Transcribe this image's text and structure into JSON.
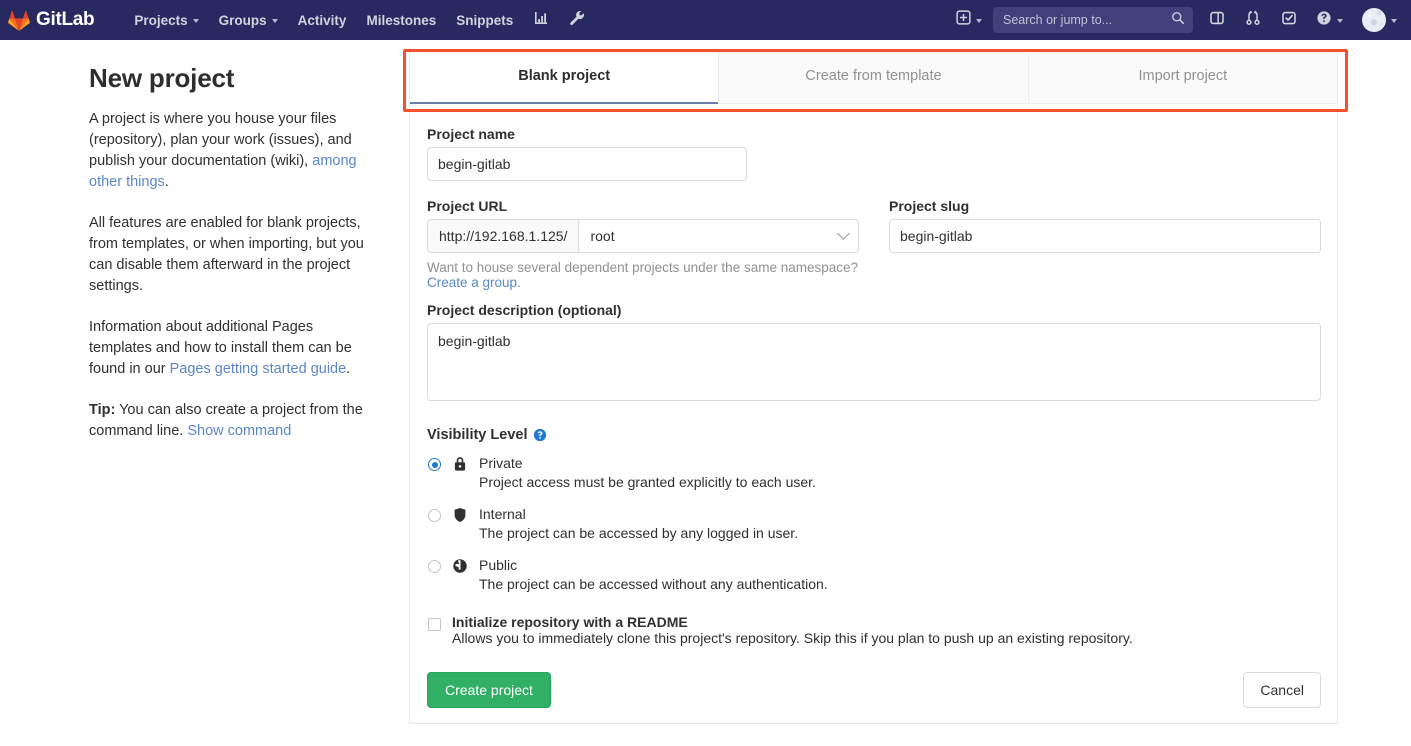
{
  "navbar": {
    "brand": "GitLab",
    "logo_icon": "gitlab-tanuki-icon",
    "items": [
      {
        "label": "Projects",
        "icon": "chevron-down-icon",
        "has_caret": true
      },
      {
        "label": "Groups",
        "icon": "chevron-down-icon",
        "has_caret": true
      },
      {
        "label": "Activity",
        "has_caret": false
      },
      {
        "label": "Milestones",
        "has_caret": false
      },
      {
        "label": "Snippets",
        "has_caret": false
      }
    ],
    "analytics_icon": "analytics-chart-icon",
    "admin_icon": "wrench-icon",
    "new_icon": "plus-square-icon",
    "search": {
      "placeholder": "Search or jump to...",
      "value": "",
      "icon": "search-icon"
    },
    "issues_icon": "issues-icon",
    "merge_requests_icon": "merge-request-icon",
    "todos_icon": "todos-checklist-icon",
    "help_icon": "question-circle-icon",
    "avatar_icon": "user-avatar",
    "bg_color": "#292961",
    "search_bg_color": "#40407a"
  },
  "left": {
    "title": "New project",
    "p1_a": "A project is where you house your files (repository), plan your work (issues), and publish your documentation (wiki), ",
    "p1_link": "among other things",
    "p1_b": ".",
    "p2": "All features are enabled for blank projects, from templates, or when importing, but you can disable them afterward in the project settings.",
    "p3_a": "Information about additional Pages templates and how to install them can be found in our ",
    "p3_link": "Pages getting started guide",
    "p3_b": ".",
    "tip_label": "Tip:",
    "tip_a": " You can also create a project from the command line. ",
    "tip_link": "Show command"
  },
  "tabs": [
    {
      "label": "Blank project",
      "active": true
    },
    {
      "label": "Create from template",
      "active": false
    },
    {
      "label": "Import project",
      "active": false
    }
  ],
  "form": {
    "project_name": {
      "label": "Project name",
      "value": "begin-gitlab",
      "placeholder": ""
    },
    "project_url": {
      "label": "Project URL",
      "prefix": "http://192.168.1.125/",
      "namespace": "root",
      "chevron_icon": "chevron-down-icon"
    },
    "project_slug": {
      "label": "Project slug",
      "value": "begin-gitlab",
      "placeholder": ""
    },
    "namespace_helper_text": "Want to house several dependent projects under the same namespace? ",
    "namespace_helper_link": "Create a group",
    "namespace_helper_tail": ".",
    "description": {
      "label": "Project description (optional)",
      "value": "begin-gitlab",
      "placeholder": ""
    },
    "visibility": {
      "title": "Visibility Level",
      "help_icon": "question-circle-icon",
      "options": [
        {
          "name": "Private",
          "description": "Project access must be granted explicitly to each user.",
          "icon": "lock-icon",
          "selected": true
        },
        {
          "name": "Internal",
          "description": "The project can be accessed by any logged in user.",
          "icon": "shield-icon",
          "selected": false
        },
        {
          "name": "Public",
          "description": "The project can be accessed without any authentication.",
          "icon": "globe-icon",
          "selected": false
        }
      ]
    },
    "readme": {
      "title": "Initialize repository with a README",
      "description": "Allows you to immediately clone this project's repository. Skip this if you plan to push up an existing repository.",
      "checked": false
    },
    "submit_label": "Create project",
    "cancel_label": "Cancel"
  },
  "annotation": {
    "color": "#f4512c",
    "target": "project-type-tabs"
  },
  "colors": {
    "primary_button": "#31af64",
    "link": "#5b87c6",
    "radio_selected": "#1f78d1",
    "tab_underline": "#6b7daa"
  }
}
